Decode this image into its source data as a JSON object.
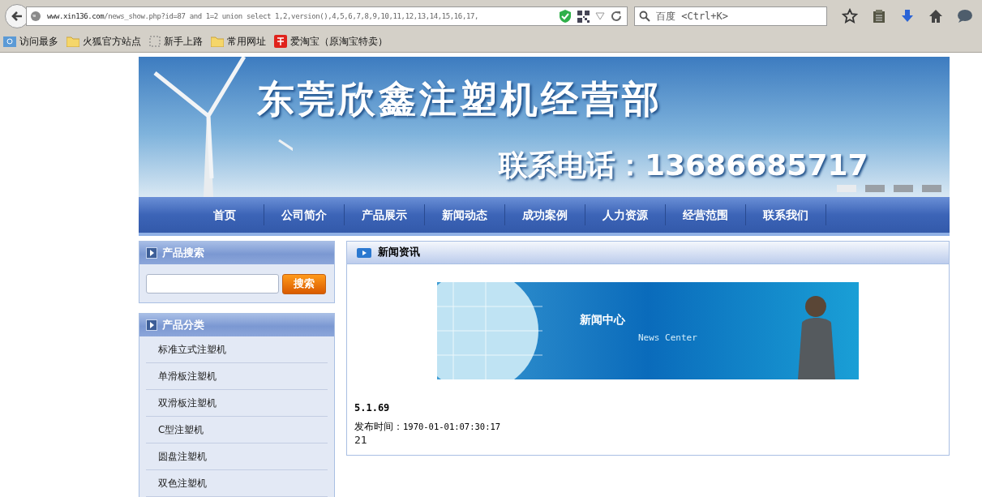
{
  "browser": {
    "url_domain": "www.xin136.com",
    "url_path": "/news_show.php?id=87 and 1=2 union select 1,2,version(),4,5,6,7,8,9,10,11,12,13,14,15,16,17,",
    "search_placeholder": "百度 <Ctrl+K>",
    "bookmarks": [
      {
        "label": "访问最多",
        "kind": "smart"
      },
      {
        "label": "火狐官方站点",
        "kind": "folder"
      },
      {
        "label": "新手上路",
        "kind": "blank"
      },
      {
        "label": "常用网址",
        "kind": "folder"
      },
      {
        "label": "爱淘宝（原淘宝特卖）",
        "kind": "taobao"
      }
    ]
  },
  "header": {
    "title": "东莞欣鑫注塑机经营部",
    "phone": "联系电话：13686685717"
  },
  "nav": [
    "首页",
    "公司简介",
    "产品展示",
    "新闻动态",
    "成功案例",
    "人力资源",
    "经营范围",
    "联系我们"
  ],
  "search_panel": {
    "title": "产品搜索",
    "button": "搜索"
  },
  "category_panel": {
    "title": "产品分类",
    "items": [
      "标准立式注塑机",
      "单滑板注塑机",
      "双滑板注塑机",
      "C型注塑机",
      "圆盘注塑机",
      "双色注塑机"
    ]
  },
  "news": {
    "title": "新闻资讯",
    "banner_title": "新闻中心",
    "banner_subtitle": "News Center",
    "article_title": "5.1.69",
    "date_label": "发布时间：",
    "date": "1970-01-01:07:30:17",
    "body": "21"
  }
}
